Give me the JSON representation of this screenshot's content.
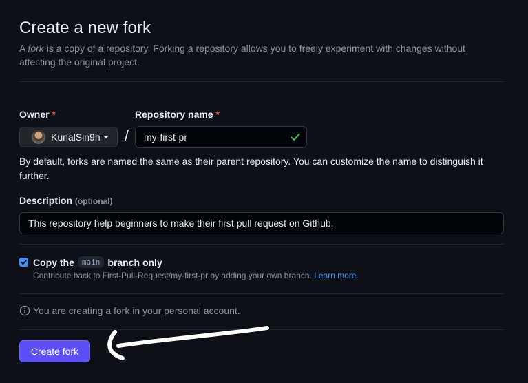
{
  "header": {
    "title": "Create a new fork",
    "subtitle_prefix": "A ",
    "subtitle_em": "fork",
    "subtitle_rest": " is a copy of a repository. Forking a repository allows you to freely experiment with changes without affecting the original project."
  },
  "owner": {
    "label": "Owner",
    "required_mark": "*",
    "selected": "KunalSin9h"
  },
  "separator": "/",
  "repository": {
    "label": "Repository name",
    "required_mark": "*",
    "value": "my-first-pr",
    "valid": true
  },
  "name_help": "By default, forks are named the same as their parent repository. You can customize the name to distinguish it further.",
  "description": {
    "label": "Description",
    "optional_label": "(optional)",
    "value": "This repository help beginners to make their first pull request on Github."
  },
  "copy_branch": {
    "checked": true,
    "label_prefix": "Copy the",
    "branch": "main",
    "label_suffix": "branch only",
    "note": "Contribute back to First-Pull-Request/my-first-pr by adding your own branch.",
    "learn_more": "Learn more."
  },
  "info": {
    "text": "You are creating a fork in your personal account."
  },
  "actions": {
    "create_label": "Create fork"
  },
  "colors": {
    "background": "#0d1117",
    "primary_button": "#5b4ff5",
    "link": "#4493f8",
    "valid_check": "#3fb950",
    "required": "#f85149"
  },
  "icons": [
    "chevron-down-icon",
    "check-icon",
    "info-icon",
    "annotation-arrow"
  ]
}
